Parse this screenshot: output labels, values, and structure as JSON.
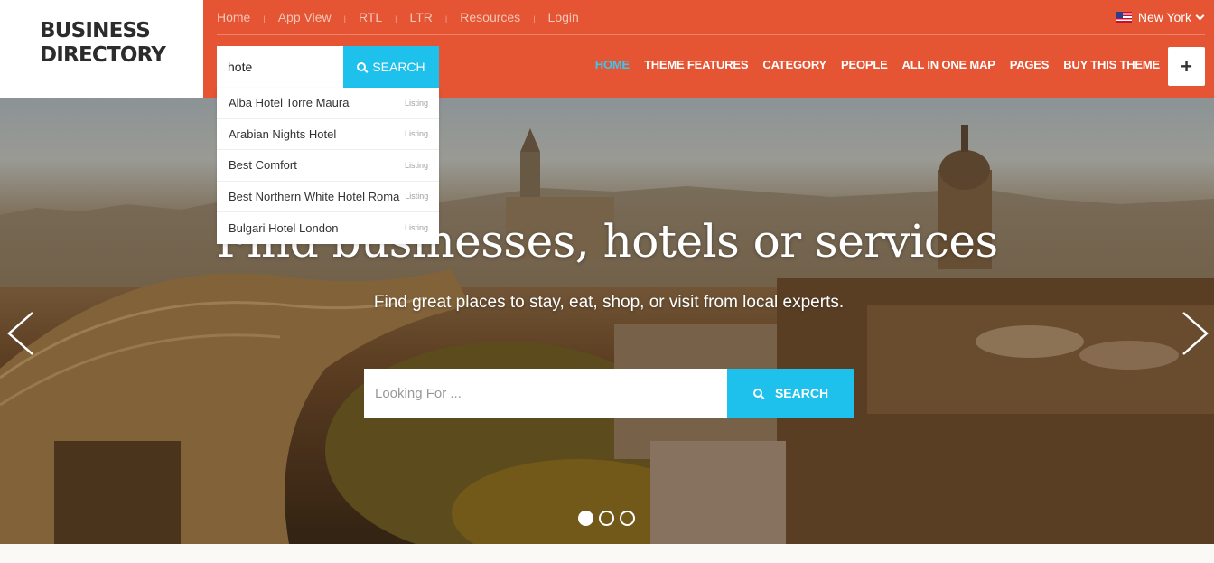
{
  "logo": {
    "line1": "BUSINESS",
    "line2": "DIRECTORY"
  },
  "topbar": {
    "links": [
      "Home",
      "App View",
      "RTL",
      "LTR",
      "Resources",
      "Login"
    ],
    "separator": "|",
    "city": "New York"
  },
  "header_search": {
    "value": "hote",
    "button_label": "SEARCH"
  },
  "autocomplete": {
    "items": [
      {
        "name": "Alba Hotel Torre Maura",
        "type": "Listing"
      },
      {
        "name": "Arabian Nights Hotel",
        "type": "Listing"
      },
      {
        "name": "Best Comfort",
        "type": "Listing"
      },
      {
        "name": "Best Northern White Hotel Roma",
        "type": "Listing"
      },
      {
        "name": "Bulgari Hotel London",
        "type": "Listing"
      }
    ]
  },
  "nav": {
    "items": [
      "HOME",
      "THEME FEATURES",
      "CATEGORY",
      "PEOPLE",
      "ALL IN ONE MAP",
      "PAGES",
      "BUY THIS THEME"
    ],
    "active": "HOME",
    "add_icon": "plus-icon"
  },
  "hero": {
    "title": "Find businesses, hotels or services",
    "subtitle": "Find great places to stay, eat, shop, or visit from local experts.",
    "search": {
      "placeholder": "Looking For ...",
      "button_label": "SEARCH"
    },
    "slides": {
      "count": 3,
      "active": 1
    }
  },
  "colors": {
    "brand": "#e55433",
    "accent": "#1ec0ec",
    "active_nav": "#3cc6f0"
  },
  "icons": {
    "search": "search-icon",
    "prev": "chevron-left-icon",
    "next": "chevron-right-icon",
    "flag": "us-flag-icon",
    "dropdown": "chevron-down-icon"
  }
}
